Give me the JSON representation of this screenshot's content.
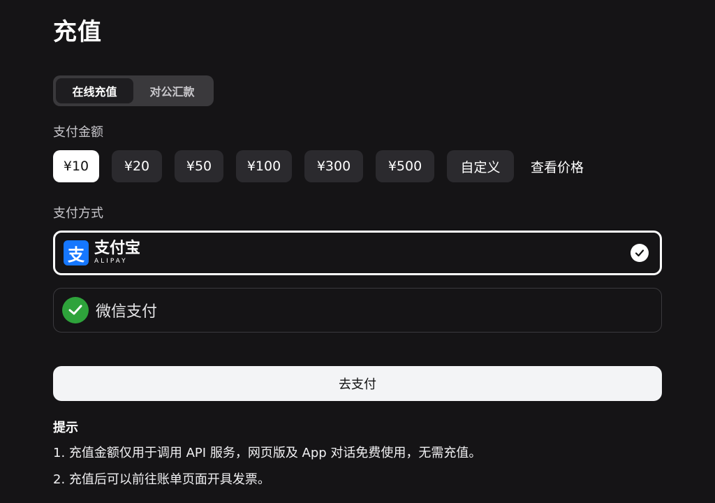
{
  "header": {
    "title": "充值"
  },
  "tabs": [
    {
      "label": "在线充值",
      "active": true
    },
    {
      "label": "对公汇款",
      "active": false
    }
  ],
  "amount_section": {
    "label": "支付金额",
    "options": [
      {
        "label": "¥10",
        "selected": true
      },
      {
        "label": "¥20",
        "selected": false
      },
      {
        "label": "¥50",
        "selected": false
      },
      {
        "label": "¥100",
        "selected": false
      },
      {
        "label": "¥300",
        "selected": false
      },
      {
        "label": "¥500",
        "selected": false
      },
      {
        "label": "自定义",
        "selected": false
      }
    ],
    "view_price_link": "查看价格"
  },
  "payment_section": {
    "label": "支付方式",
    "methods": [
      {
        "name": "alipay",
        "logo_text": "支",
        "label": "支付宝",
        "sublabel": "ALIPAY",
        "selected": true,
        "icon": "alipay-icon",
        "color": "#1677ff"
      },
      {
        "name": "wechat",
        "label": "微信支付",
        "selected": false,
        "icon": "wechat-pay-icon",
        "color": "#2ea33b"
      }
    ]
  },
  "pay_button": {
    "label": "去支付"
  },
  "tips": {
    "title": "提示",
    "items": [
      "1. 充值金额仅用于调用 API 服务，网页版及 App 对话免费使用，无需充值。",
      "2. 充值后可以前往账单页面开具发票。"
    ]
  }
}
